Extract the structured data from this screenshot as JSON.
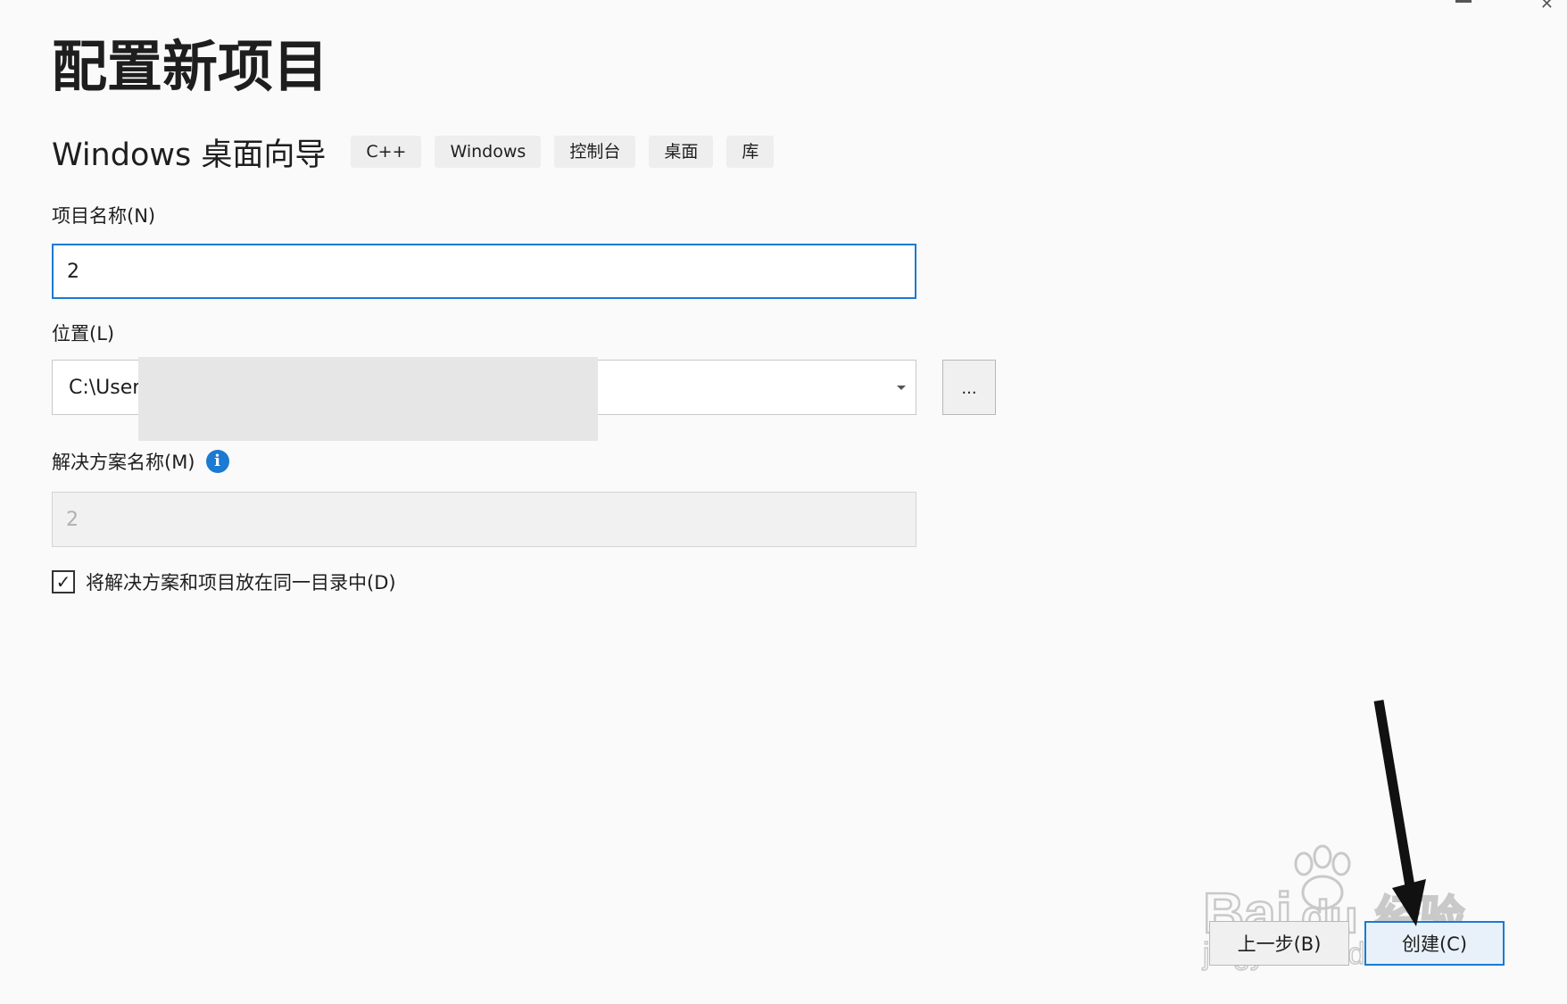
{
  "page": {
    "title": "配置新项目"
  },
  "template": {
    "name": "Windows 桌面向导",
    "tags": [
      "C++",
      "Windows",
      "控制台",
      "桌面",
      "库"
    ]
  },
  "fields": {
    "project_name": {
      "label": "项目名称(N)",
      "value": "2"
    },
    "location": {
      "label": "位置(L)",
      "value": "C:\\Users",
      "browse_label": "..."
    },
    "solution_name": {
      "label": "解决方案名称(M)",
      "value": "2"
    },
    "same_directory": {
      "label": "将解决方案和项目放在同一目录中(D)",
      "checked": true,
      "check_glyph": "✓"
    }
  },
  "icons": {
    "info": "i",
    "close": "✕"
  },
  "footer": {
    "back_label": "上一步(B)",
    "create_label": "创建(C)"
  },
  "watermark": {
    "brand_text": "Bai",
    "brand_suffix": "du",
    "product_text": "经验",
    "url_text": "jingyan.baidu.com"
  },
  "colors": {
    "accent": "#1b7ad1",
    "background": "#fafafa",
    "disabled_field": "#f1f1f1"
  }
}
